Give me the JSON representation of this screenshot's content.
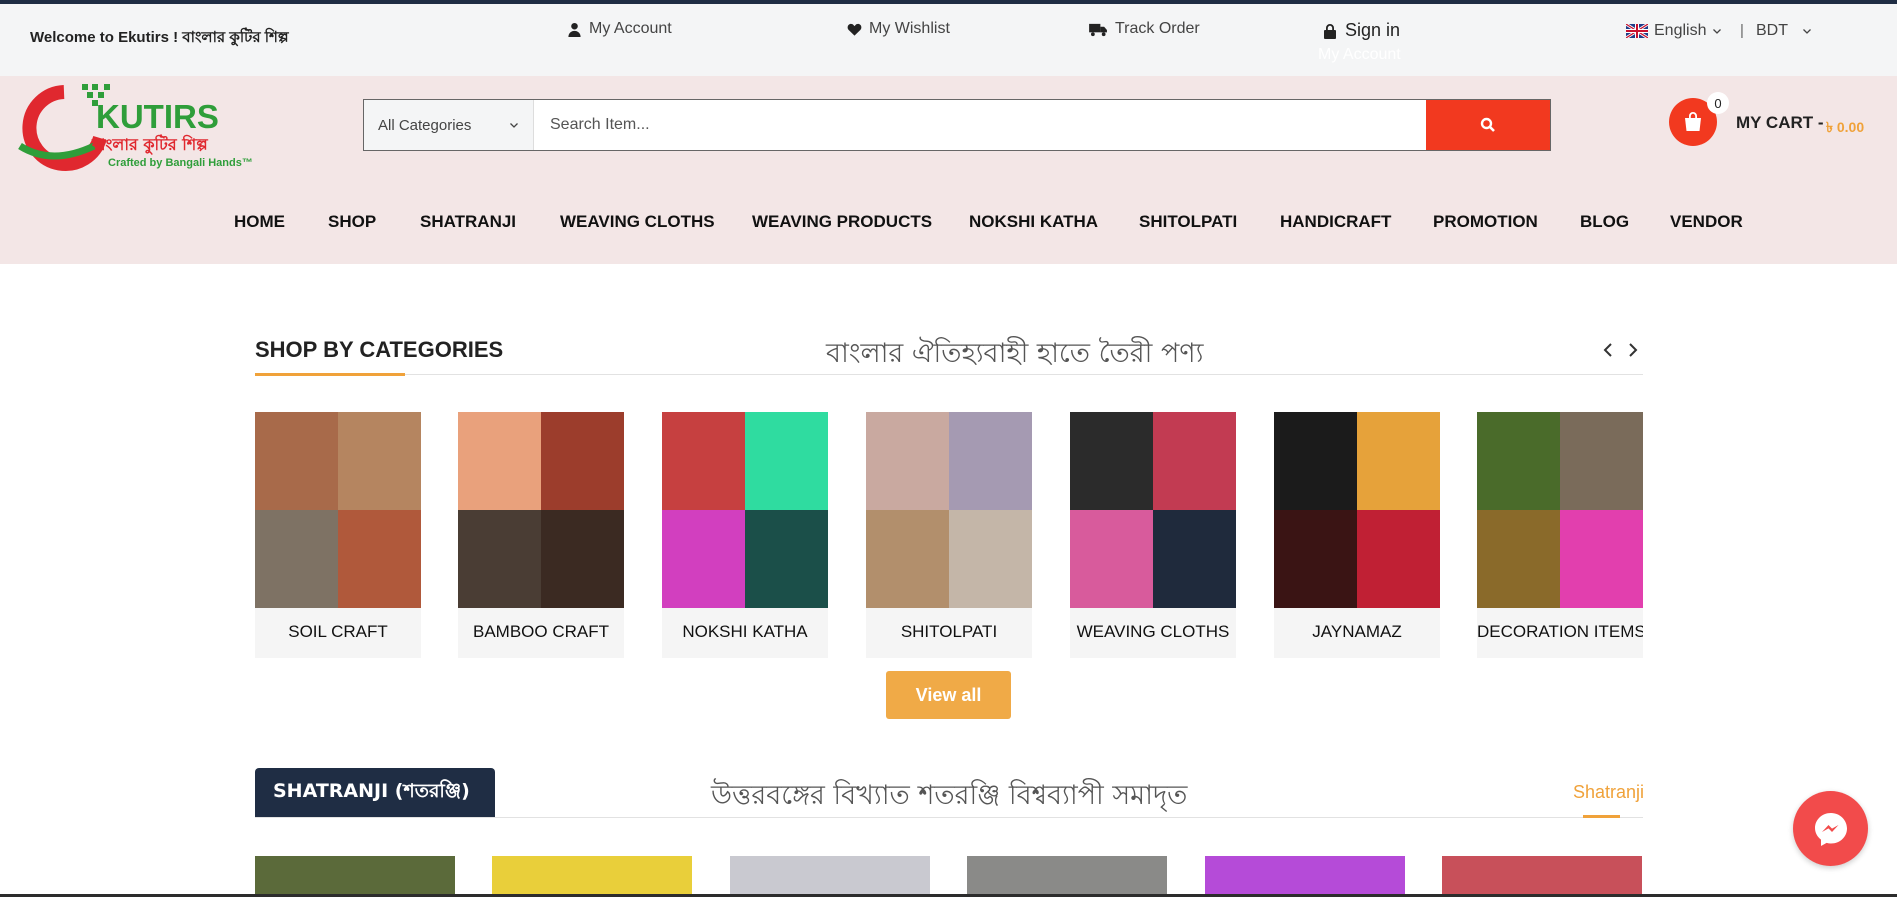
{
  "topbar": {
    "welcome": "Welcome to Ekutirs ! বাংলার কুটির শিল্প",
    "my_account": "My Account",
    "my_wishlist": "My Wishlist",
    "track_order": "Track Order",
    "sign_in": "Sign in",
    "sign_in_sub": "My Account",
    "language": "English",
    "separator": "|",
    "currency": "BDT"
  },
  "header": {
    "logo": {
      "brand": "KUTIRS",
      "bangla": "বাংলার কুটির শিল্প",
      "tagline": "Crafted by Bangali Hands™"
    },
    "search": {
      "category": "All Categories",
      "placeholder": "Search Item..."
    },
    "cart": {
      "count": "0",
      "label": "MY CART -",
      "total": "৳ 0.00"
    }
  },
  "nav": [
    "HOME",
    "SHOP",
    "SHATRANJI",
    "WEAVING CLOTHS",
    "WEAVING PRODUCTS",
    "NOKSHI KATHA",
    "SHITOLPATI",
    "HANDICRAFT",
    "PROMOTION",
    "BLOG",
    "VENDOR"
  ],
  "categories_section": {
    "title": "SHOP BY CATEGORIES",
    "tagline": "বাংলার ঐতিহ্যবাহী হাতে তৈরী পণ্য",
    "items": [
      {
        "label": "SOIL CRAFT",
        "colors": [
          "#a86a4a",
          "#b58560",
          "#7e7264",
          "#b0593b"
        ]
      },
      {
        "label": "BAMBOO CRAFT",
        "colors": [
          "#e9a17c",
          "#9c3d2c",
          "#4a3d34",
          "#3b2a22"
        ]
      },
      {
        "label": "NOKSHI KATHA",
        "colors": [
          "#c64040",
          "#2fdca0",
          "#d23fbf",
          "#1b4f49"
        ]
      },
      {
        "label": "SHITOLPATI",
        "colors": [
          "#c9a9a0",
          "#a59ab2",
          "#b28f6c",
          "#c4b6a8"
        ]
      },
      {
        "label": "WEAVING CLOTHS",
        "colors": [
          "#2b2b2b",
          "#c23b52",
          "#d85b9c",
          "#1f2a3c"
        ]
      },
      {
        "label": "JAYNAMAZ",
        "colors": [
          "#1b1b1b",
          "#e6a23a",
          "#3a1414",
          "#c02034"
        ]
      },
      {
        "label": "DECORATION ITEMS",
        "colors": [
          "#4a6b2a",
          "#7a6b5a",
          "#8a6a2a",
          "#e23fae"
        ]
      }
    ],
    "view_all": "View all"
  },
  "shatranji_section": {
    "tab": "SHATRANJI (শতরঞ্জি)",
    "tagline": "উত্তরবঙ্গের বিখ্যাত শতরঞ্জি বিশ্বব্যাপী সমাদৃত",
    "link": "Shatranji",
    "product_colors": [
      "#5b6a3a",
      "#e9cf3a",
      "#c9c9d0",
      "#8a8a88",
      "#b54bd8",
      "#c8505a"
    ]
  },
  "colors": {
    "accent": "#f0a23a",
    "search_button": "#f2391f",
    "header_bg": "#f3e6e6",
    "dark_navy": "#1f2d44",
    "messenger": "#f24b4b"
  }
}
